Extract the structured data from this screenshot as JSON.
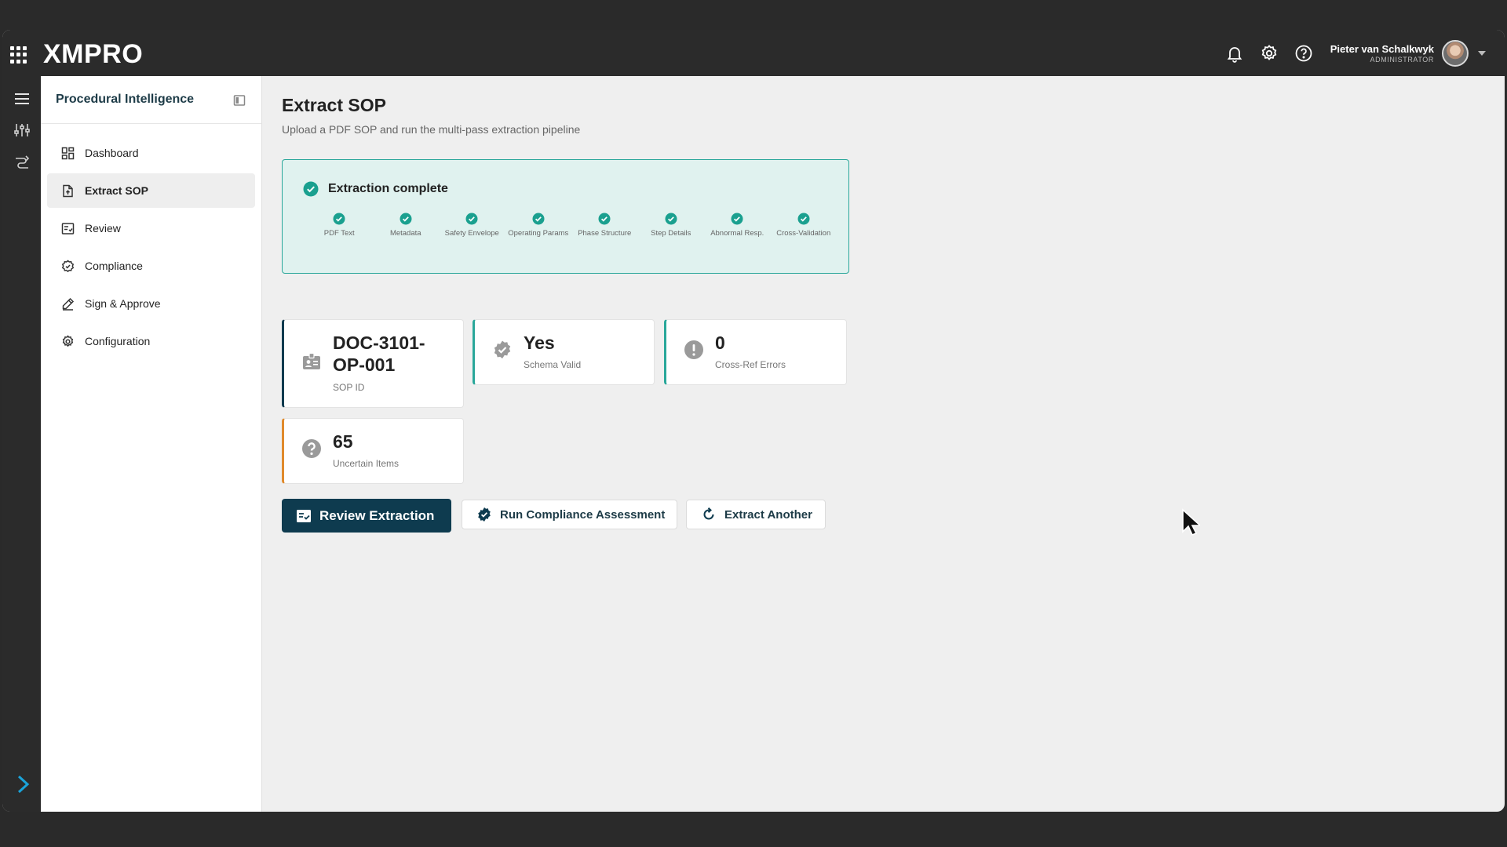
{
  "header": {
    "logo": "XMPRO",
    "user_name": "Pieter van Schalkwyk",
    "user_role": "ADMINISTRATOR"
  },
  "sidebar": {
    "title": "Procedural Intelligence",
    "items": [
      {
        "label": "Dashboard",
        "icon": "dashboard-icon"
      },
      {
        "label": "Extract SOP",
        "icon": "file-upload-icon",
        "active": true
      },
      {
        "label": "Review",
        "icon": "review-icon"
      },
      {
        "label": "Compliance",
        "icon": "compliance-icon"
      },
      {
        "label": "Sign & Approve",
        "icon": "sign-icon"
      },
      {
        "label": "Configuration",
        "icon": "gear-icon"
      }
    ]
  },
  "main": {
    "title": "Extract SOP",
    "subtitle": "Upload a PDF SOP and run the multi-pass extraction pipeline",
    "progress": {
      "title": "Extraction complete",
      "steps": [
        {
          "label": "PDF Text"
        },
        {
          "label": "Metadata"
        },
        {
          "label": "Safety Envelope"
        },
        {
          "label": "Operating Params"
        },
        {
          "label": "Phase Structure"
        },
        {
          "label": "Step Details"
        },
        {
          "label": "Abnormal Resp."
        },
        {
          "label": "Cross-Validation"
        }
      ]
    },
    "stats": [
      {
        "value": "DOC-3101-\nOP-001",
        "label": "SOP ID",
        "accent": "#0e3b4f",
        "icon": "id-badge-icon"
      },
      {
        "value": "Yes",
        "label": "Schema Valid",
        "accent": "#29a79a",
        "icon": "verified-badge-icon"
      },
      {
        "value": "0",
        "label": "Cross-Ref Errors",
        "accent": "#29a79a",
        "icon": "alert-circle-icon"
      },
      {
        "value": "65",
        "label": "Uncertain Items",
        "accent": "#e08a2c",
        "icon": "question-circle-icon"
      }
    ],
    "buttons": {
      "review": "Review Extraction",
      "compliance": "Run Compliance Assessment",
      "extract_another": "Extract Another"
    }
  },
  "colors": {
    "brand_dark": "#0e3b4f",
    "teal": "#29a79a",
    "orange": "#e08a2c",
    "topbar": "#2b2b2b"
  }
}
